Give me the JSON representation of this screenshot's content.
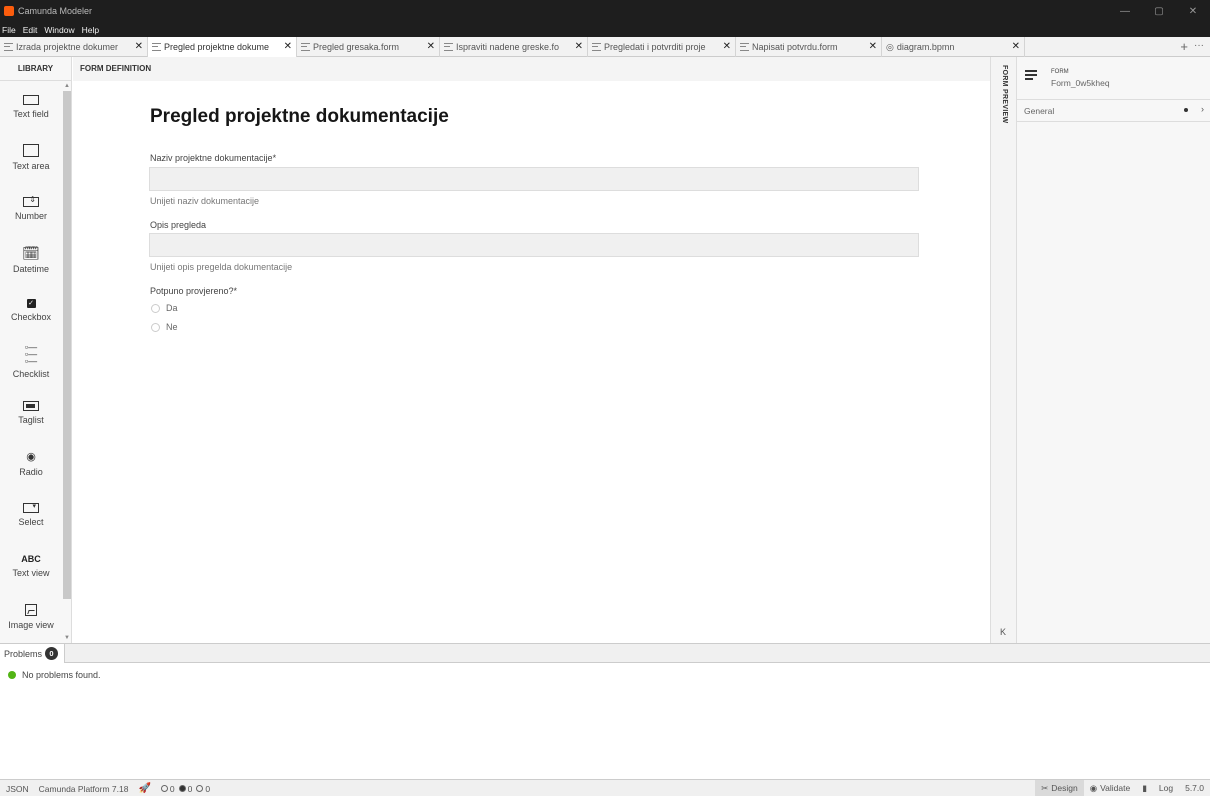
{
  "window": {
    "title": "Camunda Modeler",
    "controls": [
      "—",
      "▢",
      "✕"
    ]
  },
  "menu": [
    "File",
    "Edit",
    "Window",
    "Help"
  ],
  "tabs": [
    {
      "label": "Izrada projektne dokumer",
      "active": false
    },
    {
      "label": "Pregled projektne dokume",
      "active": true
    },
    {
      "label": "Pregled gresaka.form",
      "active": false
    },
    {
      "label": "Ispraviti nadene greske.fo",
      "active": false
    },
    {
      "label": "Pregledati i potvrditi proje",
      "active": false
    },
    {
      "label": "Napisati potvrdu.form",
      "active": false
    },
    {
      "label": "diagram.bpmn",
      "active": false
    }
  ],
  "tab_actions": {
    "add": "+",
    "more": "···"
  },
  "library": {
    "title": "LIBRARY",
    "items": [
      {
        "label": "Text field",
        "icon": "text-field-icon"
      },
      {
        "label": "Text area",
        "icon": "text-area-icon"
      },
      {
        "label": "Number",
        "icon": "number-icon"
      },
      {
        "label": "Datetime",
        "icon": "datetime-icon"
      },
      {
        "label": "Checkbox",
        "icon": "checkbox-icon"
      },
      {
        "label": "Checklist",
        "icon": "checklist-icon"
      },
      {
        "label": "Taglist",
        "icon": "taglist-icon"
      },
      {
        "label": "Radio",
        "icon": "radio-icon"
      },
      {
        "label": "Select",
        "icon": "select-icon"
      },
      {
        "label": "Text view",
        "icon": "text-view-icon",
        "glyph": "ABC"
      },
      {
        "label": "Image view",
        "icon": "image-view-icon"
      }
    ]
  },
  "form_definition": {
    "header": "FORM DEFINITION",
    "title": "Pregled projektne dokumentacije",
    "fields": [
      {
        "label": "Naziv projektne dokumentacije*",
        "description": "Unijeti naziv dokumentacije"
      },
      {
        "label": "Opis pregleda",
        "description": "Unijeti opis pregelda dokumentacije"
      }
    ],
    "radio": {
      "label": "Potpuno provjereno?*",
      "options": [
        "Da",
        "Ne"
      ]
    }
  },
  "preview": {
    "label": "FORM PREVIEW",
    "collapse": "K"
  },
  "properties": {
    "type": "FORM",
    "id": "Form_0w5kheq",
    "group": "General",
    "chevron": "›"
  },
  "problems": {
    "tab_label": "Problems",
    "count": "0",
    "message": "No problems found."
  },
  "statusbar": {
    "json": "JSON",
    "platform": "Camunda Platform 7.18",
    "dots": [
      "0",
      "0",
      "0"
    ],
    "design": "Design",
    "validate": "Validate",
    "log": "Log",
    "version": "5.7.0"
  }
}
